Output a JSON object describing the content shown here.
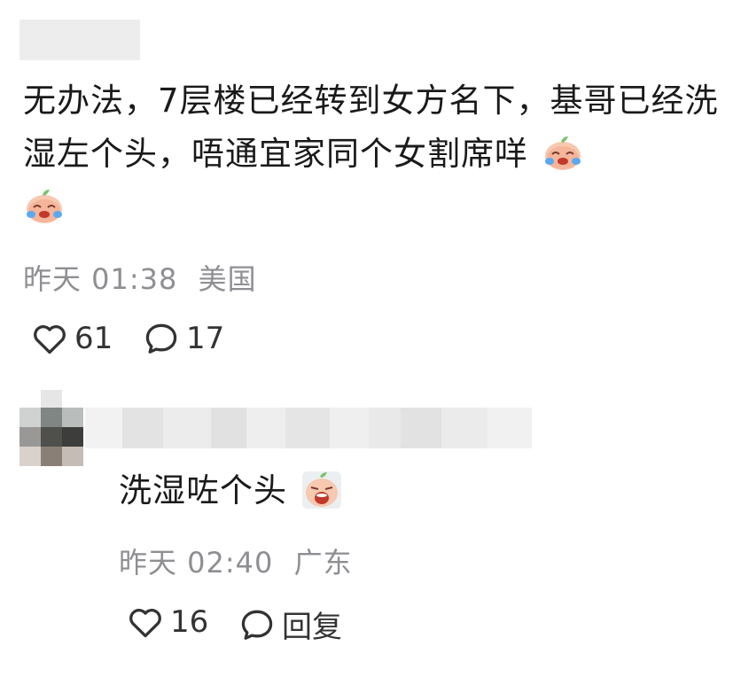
{
  "comment": {
    "username_redacted": true,
    "text": "无办法，7层楼已经转到女方名下，基哥已经洗湿左个头，唔通宜家同个女割席咩",
    "trailing_emojis": [
      "crying-laughing-peach-icon",
      "crying-laughing-peach-icon"
    ],
    "time": "昨天 01:38",
    "location": "美国",
    "likes": "61",
    "replies": "17"
  },
  "reply": {
    "username_redacted": true,
    "text": "洗湿咗个头",
    "trailing_emoji": "crying-peach-icon",
    "time": "昨天 02:40",
    "location": "广东",
    "likes": "16",
    "reply_label": "回复"
  },
  "colors": {
    "text": "#1a1a1a",
    "meta": "#8e8e93",
    "icon": "#333333"
  }
}
